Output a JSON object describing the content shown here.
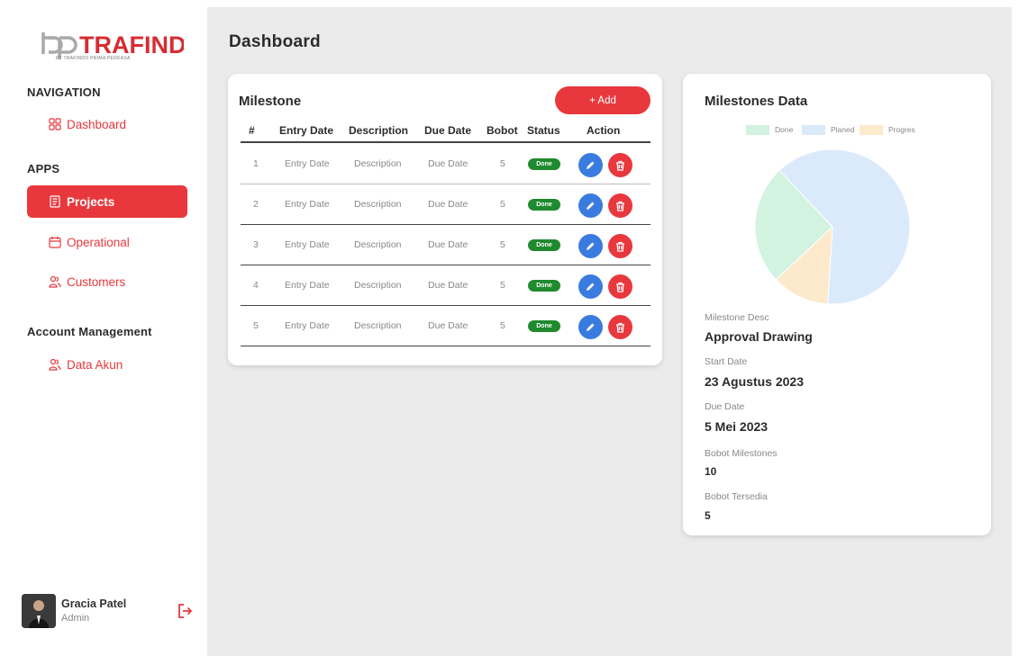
{
  "brand": {
    "name": "TRAFINDO",
    "subtitle": "PT TRAFINDO PRIMA PERKASA"
  },
  "sidebar": {
    "navigation_title": "NAVIGATION",
    "apps_title": "APPS",
    "account_title": "Account Management",
    "items": [
      {
        "label": "Dashboard",
        "icon": "grid-icon",
        "active": false
      },
      {
        "label": "Projects",
        "icon": "document-icon",
        "active": true
      },
      {
        "label": "Operational",
        "icon": "calendar-icon",
        "active": false
      },
      {
        "label": "Customers",
        "icon": "users-icon",
        "active": false
      },
      {
        "label": "Data Akun",
        "icon": "users-icon",
        "active": false
      }
    ]
  },
  "user": {
    "name": "Gracia Patel",
    "role": "Admin"
  },
  "page_title": "Dashboard",
  "milestone": {
    "title": "Milestone",
    "add_label": "+ Add",
    "columns": [
      "#",
      "Entry Date",
      "Description",
      "Due Date",
      "Bobot",
      "Status",
      "Action"
    ],
    "rows": [
      {
        "num": "1",
        "entry": "Entry Date",
        "desc": "Description",
        "due": "Due Date",
        "bobot": "5",
        "status": "Done"
      },
      {
        "num": "2",
        "entry": "Entry Date",
        "desc": "Description",
        "due": "Due Date",
        "bobot": "5",
        "status": "Done"
      },
      {
        "num": "3",
        "entry": "Entry Date",
        "desc": "Description",
        "due": "Due Date",
        "bobot": "5",
        "status": "Done"
      },
      {
        "num": "4",
        "entry": "Entry Date",
        "desc": "Description",
        "due": "Due Date",
        "bobot": "5",
        "status": "Done"
      },
      {
        "num": "5",
        "entry": "Entry Date",
        "desc": "Description",
        "due": "Due Date",
        "bobot": "5",
        "status": "Done"
      }
    ]
  },
  "data_panel": {
    "title": "Milestones Data",
    "desc_label": "Milestone Desc",
    "desc_value": "Approval Drawing",
    "start_label": "Start Date",
    "start_value": "23 Agustus 2023",
    "due_label": "Due Date",
    "due_value": "5 Mei 2023",
    "bobot_ms_label": "Bobot Milestones",
    "bobot_ms_value": "10",
    "bobot_av_label": "Bobot Tersedia",
    "bobot_av_value": "5"
  },
  "chart_data": {
    "type": "pie",
    "categories": [
      "Done",
      "Planed",
      "Progres"
    ],
    "values": [
      25,
      63,
      12
    ],
    "colors": [
      "#d2f3e0",
      "#dbeafb",
      "#fde9cc"
    ],
    "legend_position": "top"
  },
  "colors": {
    "accent": "#e8383d",
    "edit": "#3a7be0",
    "status_done": "#1f8a2e"
  }
}
